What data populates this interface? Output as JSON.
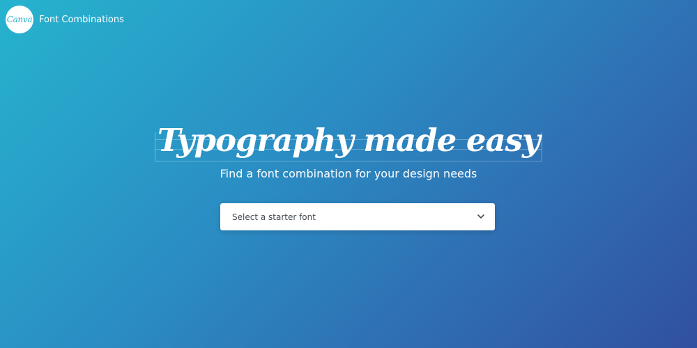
{
  "header": {
    "logo_text": "Canva",
    "app_title": "Font Combinations"
  },
  "hero": {
    "headline": "Typography made easy",
    "subtitle": "Find a font combination for your design needs"
  },
  "font_select": {
    "placeholder": "Select a starter font",
    "icon": "chevron-down-icon"
  },
  "colors": {
    "gradient_start": "#26b3ce",
    "gradient_end": "#3150a0",
    "logo_text": "#27b2cc"
  }
}
